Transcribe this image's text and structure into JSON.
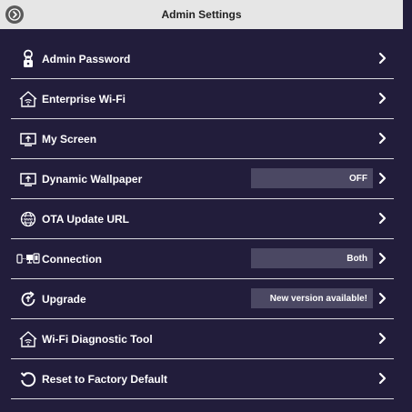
{
  "header": {
    "title": "Admin Settings",
    "back_icon": "back-arrow-icon"
  },
  "colors": {
    "background": "#221d3b",
    "header_bg": "#e6e6e6",
    "value_box_bg": "#4b4863",
    "divider": "#d9d9de",
    "text": "#ffffff"
  },
  "settings": {
    "items": [
      {
        "label": "Admin Password",
        "icon": "person-lock-icon",
        "value": ""
      },
      {
        "label": "Enterprise Wi-Fi",
        "icon": "house-wifi-icon",
        "value": ""
      },
      {
        "label": "My Screen",
        "icon": "monitor-upload-icon",
        "value": ""
      },
      {
        "label": "Dynamic Wallpaper",
        "icon": "monitor-upload-icon",
        "value": "OFF"
      },
      {
        "label": "OTA Update URL",
        "icon": "globe-www-icon",
        "value": ""
      },
      {
        "label": "Connection",
        "icon": "devices-link-icon",
        "value": "Both"
      },
      {
        "label": "Upgrade",
        "icon": "refresh-upgrade-icon",
        "value": "New version available!"
      },
      {
        "label": "Wi-Fi Diagnostic Tool",
        "icon": "house-wifi-icon",
        "value": ""
      },
      {
        "label": "Reset to Factory Default",
        "icon": "reset-arrow-icon",
        "value": ""
      }
    ]
  }
}
